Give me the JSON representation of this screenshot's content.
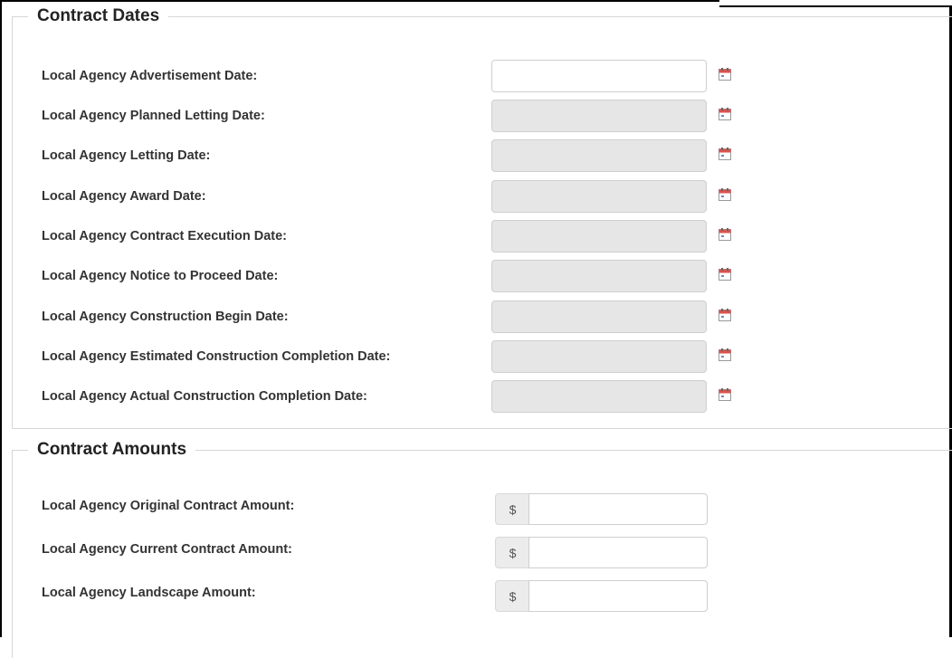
{
  "contract_dates": {
    "legend": "Contract Dates",
    "fields": [
      {
        "label": "Local Agency Advertisement Date:",
        "value": "",
        "disabled": false
      },
      {
        "label": "Local Agency Planned Letting Date:",
        "value": "",
        "disabled": true
      },
      {
        "label": "Local Agency Letting Date:",
        "value": "",
        "disabled": true
      },
      {
        "label": "Local Agency Award Date:",
        "value": "",
        "disabled": true
      },
      {
        "label": "Local Agency Contract Execution Date:",
        "value": "",
        "disabled": true
      },
      {
        "label": "Local Agency Notice to Proceed Date:",
        "value": "",
        "disabled": true
      },
      {
        "label": "Local Agency Construction Begin Date:",
        "value": "",
        "disabled": true
      },
      {
        "label": "Local Agency Estimated Construction Completion Date:",
        "value": "",
        "disabled": true
      },
      {
        "label": "Local Agency Actual Construction Completion Date:",
        "value": "",
        "disabled": true
      }
    ],
    "icon": "calendar-icon"
  },
  "contract_amounts": {
    "legend": "Contract Amounts",
    "currency_symbol": "$",
    "fields": [
      {
        "label": "Local Agency Original Contract Amount:",
        "value": ""
      },
      {
        "label": "Local Agency Current Contract Amount:",
        "value": ""
      },
      {
        "label": "Local Agency Landscape Amount:",
        "value": ""
      }
    ]
  },
  "colors": {
    "disabled_bg": "#e6e6e6",
    "calendar_red": "#d9534f"
  }
}
